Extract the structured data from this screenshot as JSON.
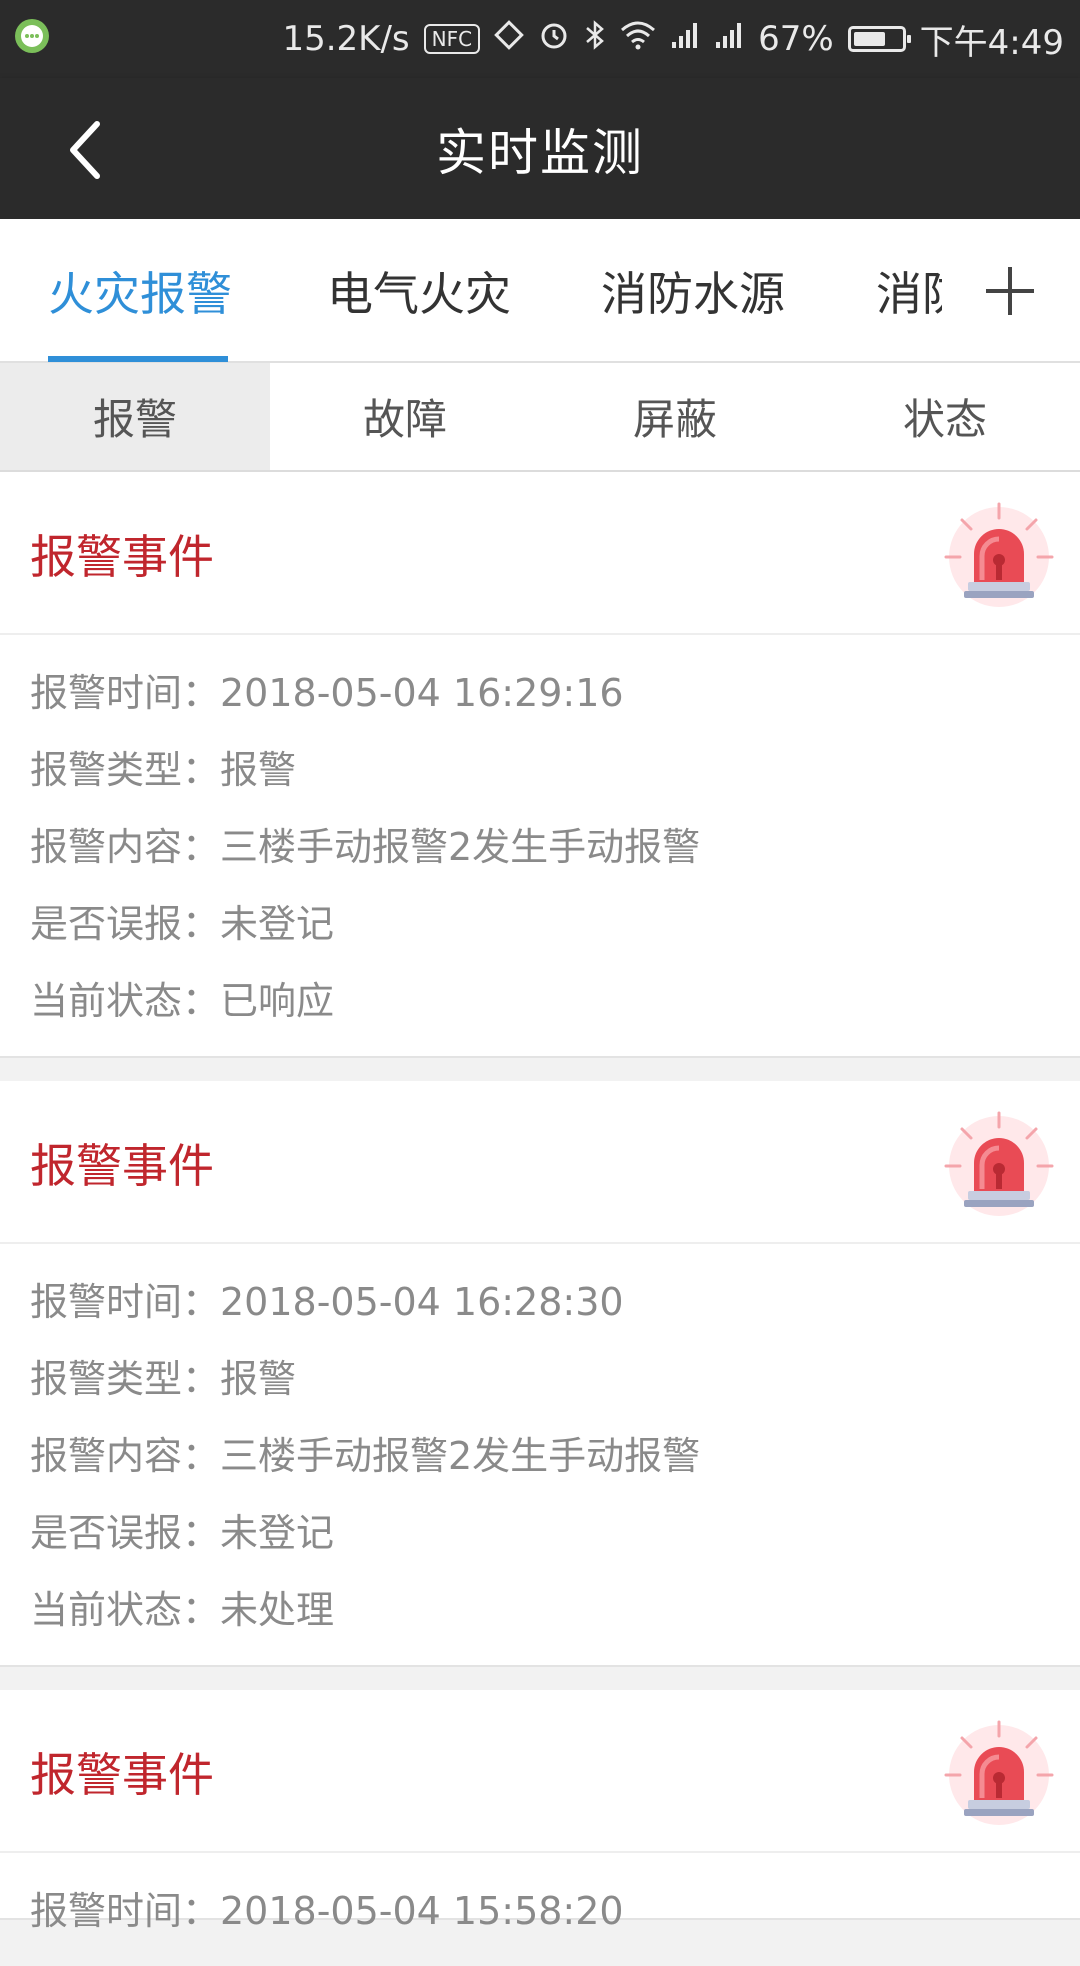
{
  "status_bar": {
    "speed": "15.2K/s",
    "nfc": "NFC",
    "battery": "67%",
    "battery_level": 0.67,
    "time": "下午4:49"
  },
  "app_bar": {
    "title": "实时监测"
  },
  "main_tabs": [
    {
      "label": "火灾报警",
      "active": true
    },
    {
      "label": "电气火灾",
      "active": false
    },
    {
      "label": "消防水源",
      "active": false
    },
    {
      "label": "消防",
      "active": false
    }
  ],
  "sub_tabs": [
    {
      "label": "报警",
      "active": true
    },
    {
      "label": "故障",
      "active": false
    },
    {
      "label": "屏蔽",
      "active": false
    },
    {
      "label": "状态",
      "active": false
    }
  ],
  "events": [
    {
      "title": "报警事件",
      "rows": [
        "报警时间：2018-05-04 16:29:16",
        "报警类型：报警",
        "报警内容：三楼手动报警2发生手动报警",
        "是否误报：未登记",
        "当前状态：已响应"
      ]
    },
    {
      "title": "报警事件",
      "rows": [
        "报警时间：2018-05-04 16:28:30",
        "报警类型：报警",
        "报警内容：三楼手动报警2发生手动报警",
        "是否误报：未登记",
        "当前状态：未处理"
      ]
    },
    {
      "title": "报警事件",
      "rows": [
        "报警时间：2018-05-04 15:58:20"
      ]
    }
  ],
  "colors": {
    "accent": "#2f8fd8",
    "alarm_red": "#c0262d",
    "bar_dark": "#2b2b2b"
  }
}
